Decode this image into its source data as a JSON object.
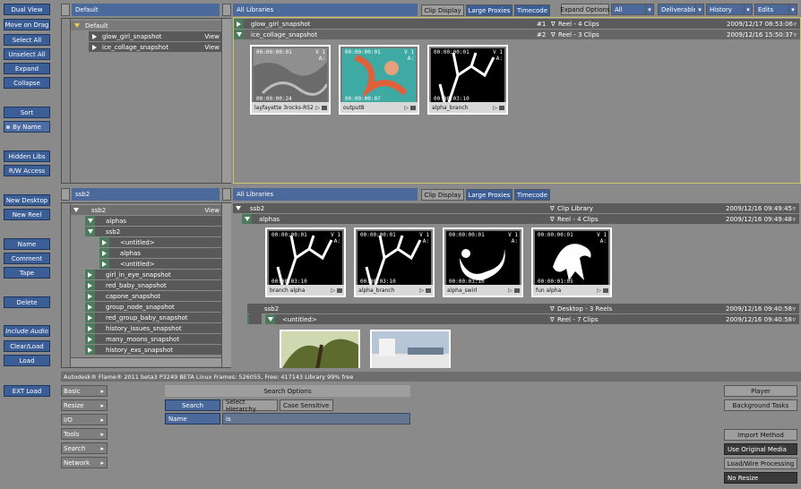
{
  "left_buttons": [
    {
      "label": "Dual View",
      "style": "blue"
    },
    {
      "label": "Move on Drag",
      "style": "blue"
    },
    {
      "label": "Select All",
      "style": "blue"
    },
    {
      "label": "Unselect All",
      "style": "blue"
    },
    {
      "label": "Expand",
      "style": "blue"
    },
    {
      "label": "Collapse",
      "style": "blue"
    },
    {
      "label": "Sort",
      "style": "blue"
    },
    {
      "label": "By Name",
      "style": "blue"
    },
    {
      "label": "Hidden Libs",
      "style": "blue"
    },
    {
      "label": "R/W Access",
      "style": "blue"
    },
    {
      "label": "New Desktop",
      "style": "blue"
    },
    {
      "label": "New Reel",
      "style": "blue"
    },
    {
      "label": "Name",
      "style": "blue"
    },
    {
      "label": "Comment",
      "style": "blue"
    },
    {
      "label": "Tape",
      "style": "blue"
    },
    {
      "label": "Delete",
      "style": "blue"
    },
    {
      "label": "Include Audio",
      "style": "blue"
    },
    {
      "label": "Clear/Load",
      "style": "blue"
    },
    {
      "label": "Load",
      "style": "blue"
    },
    {
      "label": "EXT Load",
      "style": "blue"
    }
  ],
  "top_tree": {
    "header": "Default",
    "rows": [
      {
        "label": "Default",
        "level": 0,
        "kind": "lib"
      },
      {
        "label": "glow_girl_snapshot",
        "level": 1,
        "kind": "reel",
        "extra": "View"
      },
      {
        "label": "ice_collage_snapshot",
        "level": 1,
        "kind": "reel",
        "extra": "View"
      }
    ]
  },
  "bottom_tree": {
    "header": "ssb2",
    "rows": [
      {
        "label": "ssb2",
        "level": 0,
        "extra": "View"
      },
      {
        "label": "alphas",
        "level": 1
      },
      {
        "label": "ssb2",
        "level": 1
      },
      {
        "label": "<untitled>",
        "level": 2
      },
      {
        "label": "alphas",
        "level": 2
      },
      {
        "label": "<untitled>",
        "level": 2
      },
      {
        "label": "girl_in_eye_snapshot",
        "level": 1
      },
      {
        "label": "red_baby_snapshot",
        "level": 1
      },
      {
        "label": "capone_snapshot",
        "level": 1
      },
      {
        "label": "group_node_snapshot",
        "level": 1
      },
      {
        "label": "red_group_baby_snapshot",
        "level": 1
      },
      {
        "label": "history_issues_snapshot",
        "level": 1
      },
      {
        "label": "many_moons_snapshot",
        "level": 1
      },
      {
        "label": "history_exs_snapshot",
        "level": 1
      }
    ]
  },
  "top_lib": {
    "header": "All Libraries",
    "buttons": {
      "clip_display": "Clip Display",
      "large_proxies": "Large Proxies",
      "timecode": "Timecode"
    },
    "reels": [
      {
        "name": "glow_girl_snapshot",
        "num": "#1",
        "info": "Reel - 4 Clips",
        "date": "2009/12/17 08:53:06"
      },
      {
        "name": "ice_collage_snapshot",
        "num": "#2",
        "info": "Reel - 3 Clips",
        "date": "2009/12/16 15:50:37"
      }
    ],
    "clips": [
      {
        "tc_top": "00:00:00:01",
        "tc_bot": "00:00:00:24",
        "track": "V 1",
        "track2": "A:",
        "label": "layfayette 3rocks-RS2",
        "img": "rock"
      },
      {
        "tc_top": "00:00:00:01",
        "tc_bot": "00:00:00:07",
        "track": "V 1",
        "track2": "A:",
        "label": "output8",
        "img": "fish"
      },
      {
        "tc_top": "00:00:00:01",
        "tc_bot": "00:00:03:10",
        "track": "V 1",
        "track2": "A:",
        "label": "alpha_branch",
        "img": "branch"
      }
    ]
  },
  "bottom_lib": {
    "header": "All Libraries",
    "buttons": {
      "clip_display": "Clip Display",
      "large_proxies": "Large Proxies",
      "timecode": "Timecode"
    },
    "rows": [
      {
        "name": "ssb2",
        "info": "Clip Library",
        "date": "2009/12/16 09:49:45"
      },
      {
        "name": "alphas",
        "info": "Reel - 4 Clips",
        "date": "2009/12/16 09:49:48"
      },
      {
        "name": "ssb2",
        "info": "Desktop - 3 Reels",
        "date": "2009/12/16 09:40:58"
      },
      {
        "name": "ssb2",
        "info": "",
        "date": ""
      },
      {
        "name": "<untitled>",
        "info": "Reel - 7 Clips",
        "date": "2009/12/16 09:40:58"
      }
    ],
    "clips": [
      {
        "tc_top": "00:00:00:01",
        "tc_bot": "00:00:03:10",
        "track": "V 1",
        "track2": "A:",
        "label": "branch alpha",
        "img": "branch"
      },
      {
        "tc_top": "00:00:00:01",
        "tc_bot": "00:00:03:10",
        "track": "V 1",
        "track2": "A:",
        "label": "alpha_branch",
        "img": "branch"
      },
      {
        "tc_top": "00:00:00:01",
        "tc_bot": "00:00:03:10",
        "track": "V 1",
        "track2": "A:",
        "label": "alpha_swirl",
        "img": "swirl"
      },
      {
        "tc_top": "00:00:00:01",
        "tc_bot": "00:00:01:05",
        "track": "V 1",
        "track2": "A:",
        "label": "fun alpha",
        "img": "bird"
      }
    ]
  },
  "top_options": {
    "expand_options": "Expand Options",
    "all": "All",
    "deliverables": "Deliverables",
    "history": "History",
    "edits": "Edits"
  },
  "status_bar": "Autodesk® Flame® 2011 beta3   P3249 BETA Linux   Frames: 526055, Free: 417143   Library 99% free",
  "bottom_tabs": [
    "Basic",
    "Resize",
    "I/O",
    "Tools",
    "Search",
    "Network"
  ],
  "search": {
    "options": "Search Options",
    "search": "Search",
    "hierarchy": "Select Hierarchy",
    "case": "Case Sensitive",
    "name_label": "Name",
    "field_op": "is",
    "field_value": ""
  },
  "right_buttons": {
    "player": "Player",
    "bg_tasks": "Background Tasks",
    "import_method": "Import Method",
    "use_original": "Use Original Media",
    "load_wire": "Load/Wire Processing",
    "no_resize": "No Resize"
  }
}
